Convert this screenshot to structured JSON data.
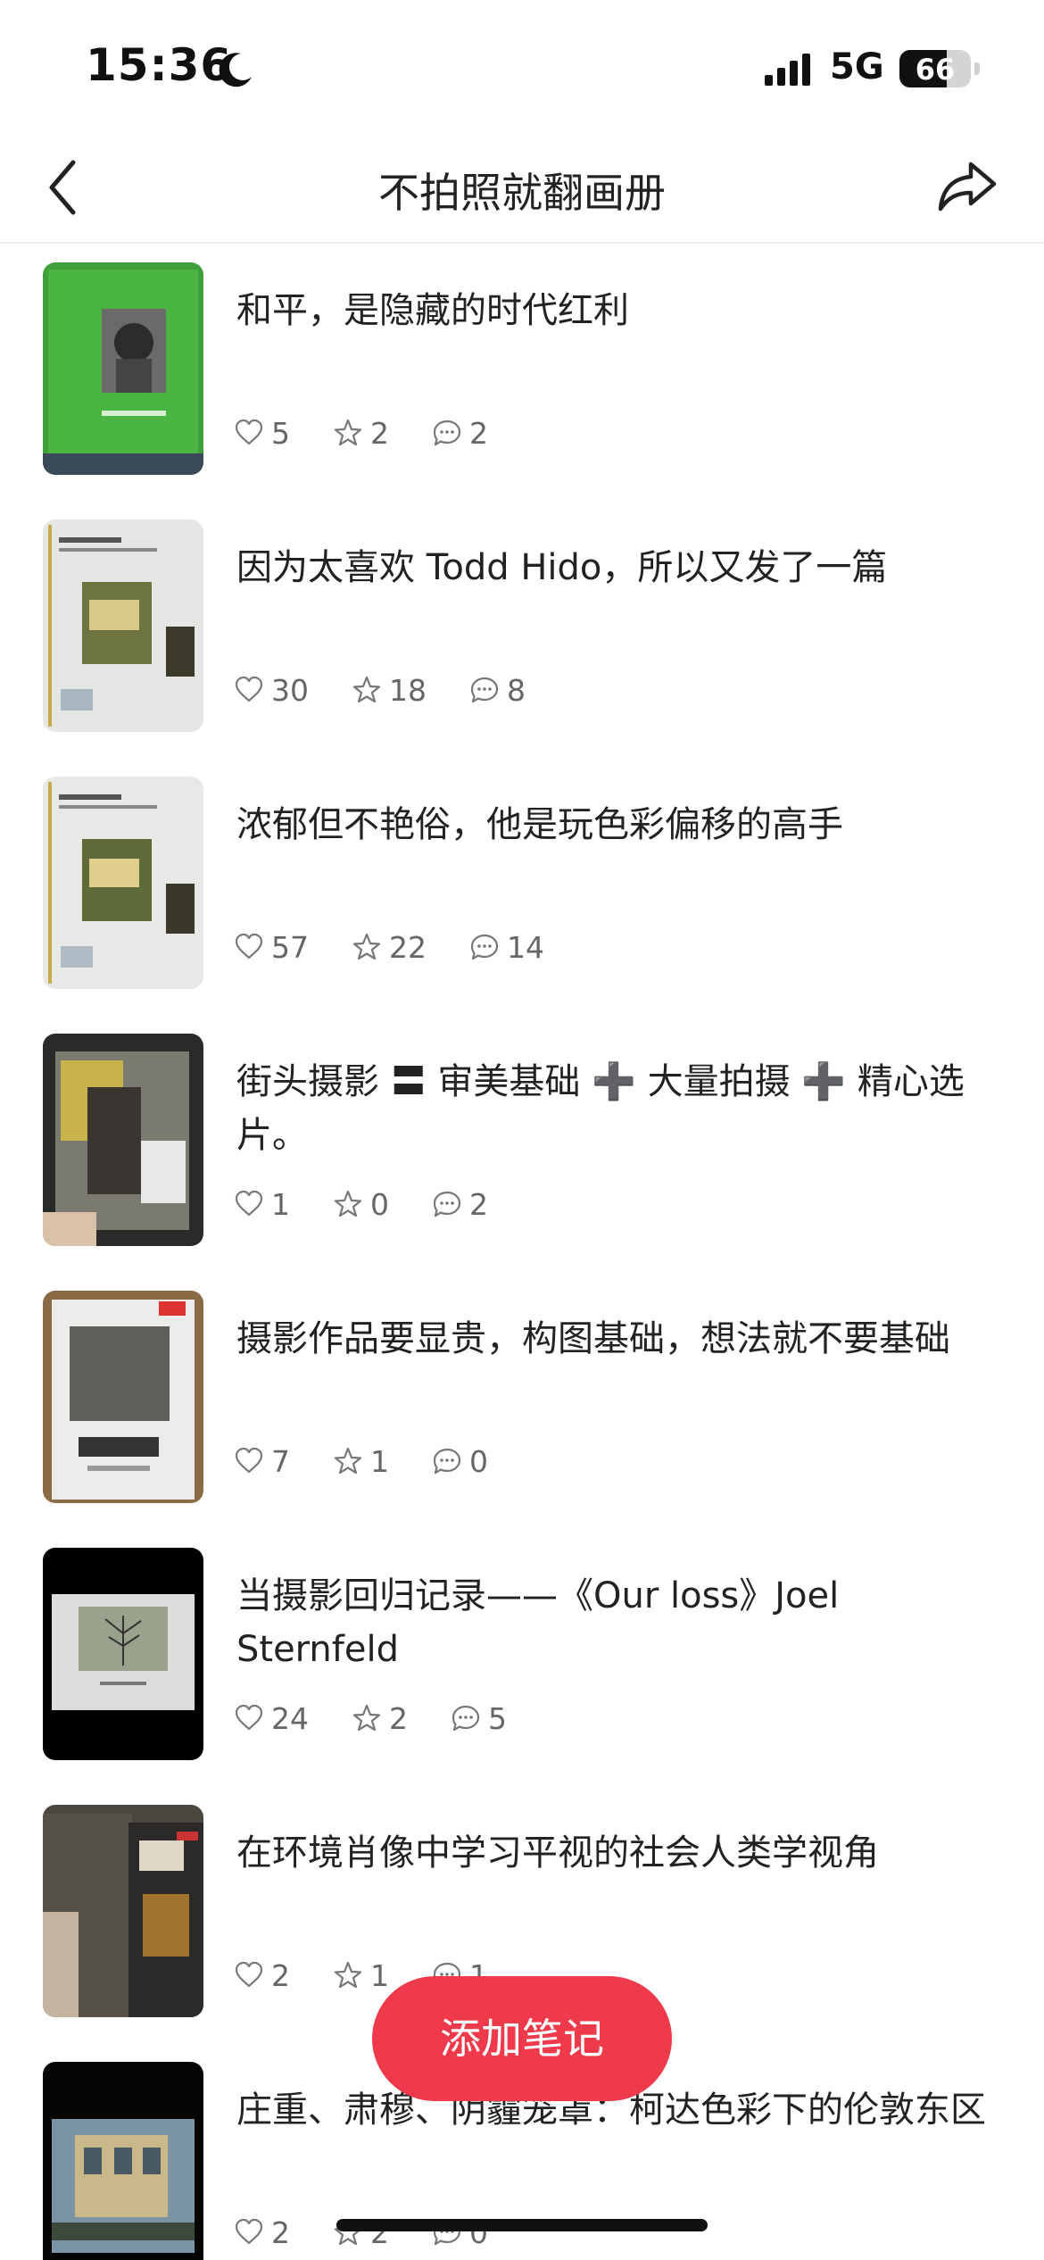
{
  "status_bar": {
    "time": "15:36",
    "network": "5G",
    "battery": "66",
    "battery_level": 0.66
  },
  "nav": {
    "title": "不拍照就翻画册",
    "back_icon": "chevron-left-icon",
    "share_icon": "share-arrow-icon"
  },
  "notes": [
    {
      "title": "和平，是隐藏的时代红利",
      "likes": "5",
      "collects": "2",
      "comments": "2"
    },
    {
      "title": "因为太喜欢 Todd Hido，所以又发了一篇",
      "likes": "30",
      "collects": "18",
      "comments": "8"
    },
    {
      "title": "浓郁但不艳俗，他是玩色彩偏移的高手",
      "likes": "57",
      "collects": "22",
      "comments": "14"
    },
    {
      "title": "街头摄影 〓 审美基础 ➕ 大量拍摄 ➕ 精心选片。",
      "likes": "1",
      "collects": "0",
      "comments": "2"
    },
    {
      "title": "摄影作品要显贵，构图基础，想法就不要基础",
      "likes": "7",
      "collects": "1",
      "comments": "0"
    },
    {
      "title": "当摄影回归记录——《Our loss》Joel Sternfeld",
      "likes": "24",
      "collects": "2",
      "comments": "5"
    },
    {
      "title": "在环境肖像中学习平视的社会人类学视角",
      "likes": "2",
      "collects": "1",
      "comments": "1"
    },
    {
      "title": "庄重、肃穆、阴霾笼罩：柯达色彩下的伦敦东区",
      "likes": "2",
      "collects": "2",
      "comments": "0"
    }
  ],
  "add_button": {
    "label": "添加笔记"
  },
  "colors": {
    "accent": "#ee3a4a",
    "text": "#222222",
    "muted": "#666666"
  }
}
